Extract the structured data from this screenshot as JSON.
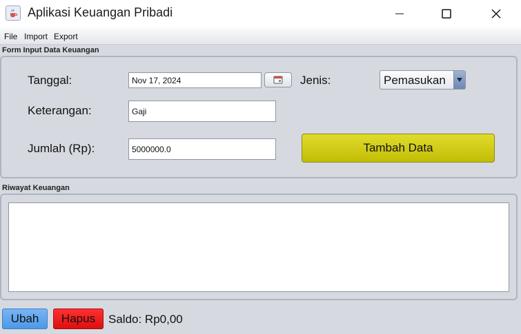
{
  "window": {
    "title": "Aplikasi Keuangan Pribadi"
  },
  "menu": {
    "items": [
      "File",
      "Import",
      "Export"
    ]
  },
  "form": {
    "section_title": "Form Input Data Keuangan",
    "tanggal_label": "Tanggal:",
    "tanggal_value": "Nov 17, 2024",
    "jenis_label": "Jenis:",
    "jenis_selected": "Pemasukan",
    "keterangan_label": "Keterangan:",
    "keterangan_value": "Gaji",
    "jumlah_label": "Jumlah (Rp):",
    "jumlah_value": "5000000.0",
    "tambah_label": "Tambah Data"
  },
  "history": {
    "section_title": "Riwayat Keuangan"
  },
  "footer": {
    "ubah_label": "Ubah",
    "hapus_label": "Hapus",
    "saldo_text": "Saldo: Rp0,00"
  },
  "colors": {
    "tambah": "#d4cf10",
    "ubah": "#5ea6ee",
    "hapus": "#f21a1a",
    "background": "#d6d9df"
  },
  "icons": {
    "app": "java-cup-icon",
    "calendar": "calendar-icon",
    "dropdown": "chevron-down-icon"
  }
}
